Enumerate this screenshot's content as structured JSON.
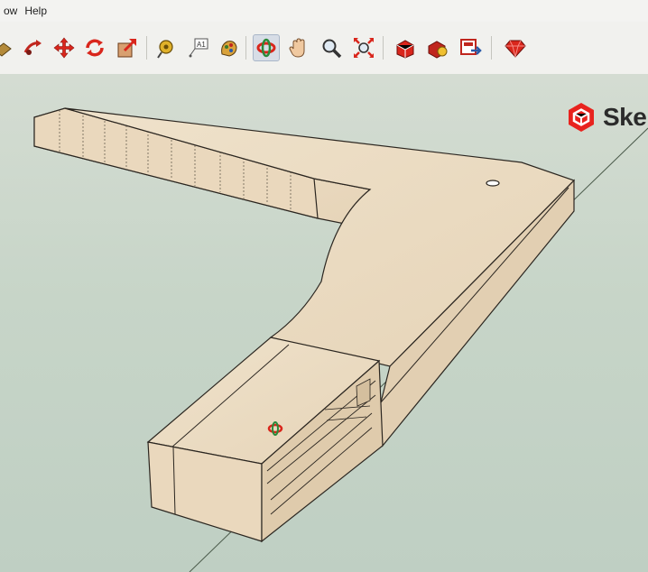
{
  "menu": {
    "items": [
      "ow",
      "Help"
    ]
  },
  "toolbar": {
    "tools": [
      {
        "name": "paint-bucket-icon",
        "color": "#8a6a2a"
      },
      {
        "name": "push-pull-icon",
        "color": "#c0261e"
      },
      {
        "name": "move-icon",
        "color": "#d9261c"
      },
      {
        "name": "rotate-icon",
        "color": "#d9261c"
      },
      {
        "name": "offset-icon",
        "color": "#d9261c"
      },
      {
        "name": "tape-measure-icon",
        "color": "#d4a21a"
      },
      {
        "name": "text-label-icon",
        "color": "#555555"
      },
      {
        "name": "paint-icon",
        "color": "#c89a2a"
      },
      {
        "name": "orbit-icon",
        "color": "#d9261c"
      },
      {
        "name": "pan-icon",
        "color": "#e7b48a"
      },
      {
        "name": "zoom-icon",
        "color": "#444444"
      },
      {
        "name": "zoom-extents-icon",
        "color": "#d9261c"
      },
      {
        "name": "warehouse-icon",
        "color": "#c0261e"
      },
      {
        "name": "components-icon",
        "color": "#c0261e"
      },
      {
        "name": "extension-icon",
        "color": "#c0261e"
      },
      {
        "name": "ruby-icon",
        "color": "#d9261c"
      }
    ]
  },
  "logo": {
    "text": "Ske",
    "color": "#e8231e"
  },
  "colors": {
    "model_face": "#ecdcc4",
    "model_side": "#e2cfb2",
    "model_edge": "#2b2620",
    "background": "#c8d6cc"
  }
}
